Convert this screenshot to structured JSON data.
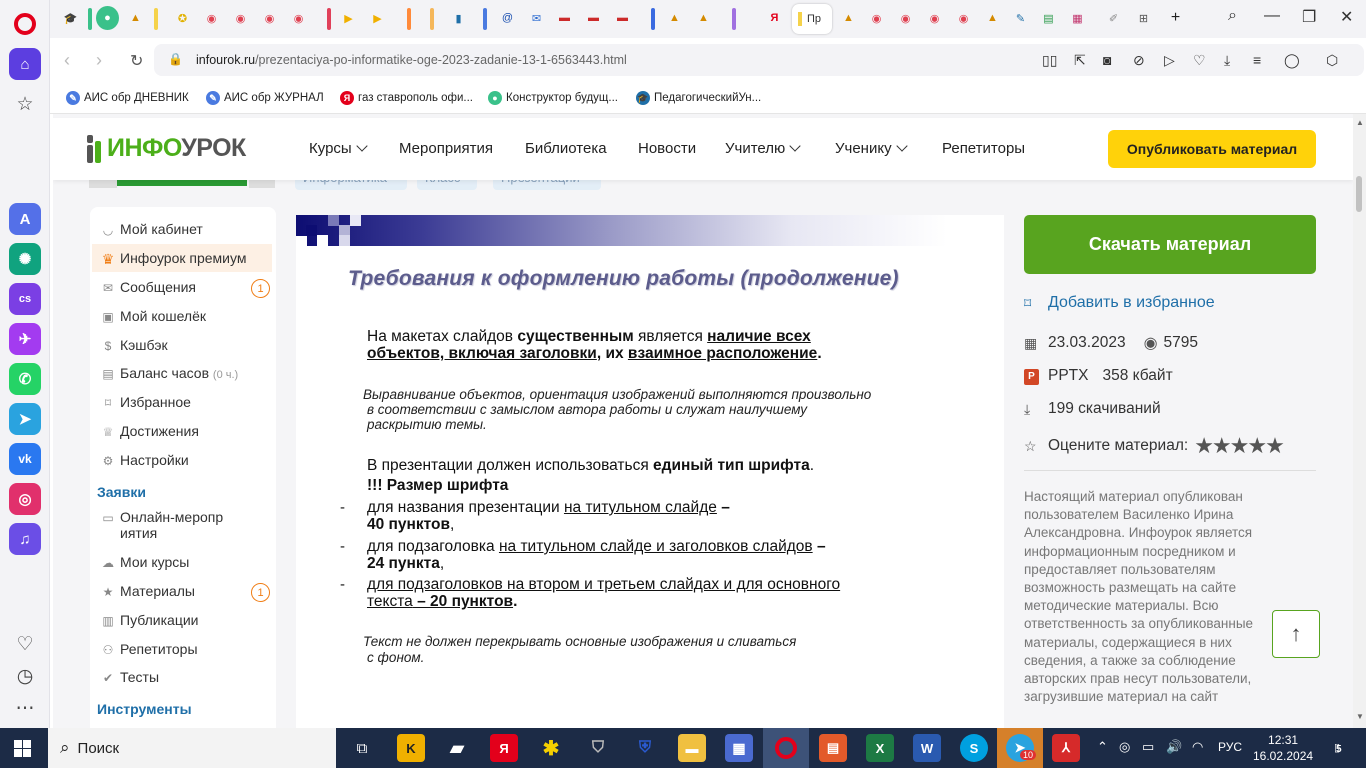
{
  "browser": {
    "active_tab_title": "Пр",
    "url_host": "infourok.ru",
    "url_path": "/prezentaciya-po-informatike-oge-2023-zadanie-13-1-6563443.html",
    "bookmarks": [
      {
        "label": "АИС обр ДНЕВНИК",
        "icon": "ais-icon"
      },
      {
        "label": "АИС обр ЖУРНАЛ",
        "icon": "ais-icon"
      },
      {
        "label": "газ ставрополь офи...",
        "icon": "yandex-icon"
      },
      {
        "label": "Конструктор будущ...",
        "icon": "constructor-icon"
      },
      {
        "label": "ПедагогическийУн...",
        "icon": "graduation-cap-icon"
      }
    ]
  },
  "site": {
    "logo_part1": "ИНФО",
    "logo_part2": "УРОК",
    "nav": [
      {
        "label": "Курсы",
        "dropdown": true
      },
      {
        "label": "Мероприятия",
        "dropdown": false
      },
      {
        "label": "Библиотека",
        "dropdown": false
      },
      {
        "label": "Новости",
        "dropdown": false
      },
      {
        "label": "Учителю",
        "dropdown": true
      },
      {
        "label": "Ученику",
        "dropdown": true
      },
      {
        "label": "Репетиторы",
        "dropdown": false
      }
    ],
    "publish_button": "Опубликовать материал",
    "tags": [
      "Информатика",
      "Класс",
      "Презентации"
    ]
  },
  "left_menu": {
    "items": [
      {
        "label": "Мой кабинет",
        "icon": "person-icon"
      },
      {
        "label": "Инфоурок премиум",
        "icon": "crown-icon"
      },
      {
        "label": "Сообщения",
        "icon": "mail-icon",
        "badge": "1"
      },
      {
        "label": "Мой кошелёк",
        "icon": "wallet-icon"
      },
      {
        "label": "Кэшбэк",
        "icon": "cashback-icon"
      },
      {
        "label": "Баланс часов",
        "icon": "clock-icon",
        "extra": "(0 ч.)"
      },
      {
        "label": "Избранное",
        "icon": "bookmark-icon"
      },
      {
        "label": "Достижения",
        "icon": "trophy-icon"
      },
      {
        "label": "Настройки",
        "icon": "gear-icon"
      }
    ],
    "section_requests": "Заявки",
    "requests": [
      {
        "label": "Онлайн-мероприятия",
        "icon": "video-icon"
      },
      {
        "label": "Мои курсы",
        "icon": "courses-icon"
      },
      {
        "label": "Материалы",
        "icon": "star-icon",
        "badge": "1"
      },
      {
        "label": "Публикации",
        "icon": "book-icon"
      },
      {
        "label": "Репетиторы",
        "icon": "people-icon"
      },
      {
        "label": "Тесты",
        "icon": "check-circle-icon"
      }
    ],
    "section_tools": "Инструменты"
  },
  "slide": {
    "title": "Требования к оформлению работы (продолжение)",
    "p1_a": "На макетах  слайдов ",
    "p1_b": "существенным",
    "p1_c": " является ",
    "p1_d": "наличие всех",
    "p1_e": "объектов, включая заголовки",
    "p1_f": ", их ",
    "p1_g": "взаимное расположение",
    "p1_h": ".",
    "p2_1": "Выравнивание объектов, ориентация изображений выполняются произвольно",
    "p2_2": "в соответствии с замыслом автора работы и служат наилучшему",
    "p2_3": "раскрытию темы.",
    "p3_a": "В презентации должен использоваться ",
    "p3_b": "единый тип шрифта",
    "p3_c": ".",
    "p4": "!!!  Размер шрифта",
    "b1_a": "для названия презентации ",
    "b1_b": "на титульном слайде",
    "b1_c": " –",
    "b1_d": "40 пунктов",
    "b1_e": ",",
    "b2_a": "для подзаголовка ",
    "b2_b": "на титульном слайде и заголовков слайдов",
    "b2_c": " –",
    "b2_d": "24 пункта",
    "b2_e": ",",
    "b3_a": "для подзаголовков на втором и третьем  слайдах и для основного",
    "b3_b": "текста",
    "b3_c": " – 20 пунктов",
    "b3_d": ".",
    "dash": "-",
    "p5_1": "Текст не должен перекрывать основные изображения и сливаться",
    "p5_2": "с фоном."
  },
  "right_panel": {
    "download_button": "Скачать материал",
    "favorite": "Добавить в избранное",
    "date": "23.03.2023",
    "views": "5795",
    "format": "PPTX",
    "size": "358 кбайт",
    "downloads": "199 скачиваний",
    "rate_label": "Оцените материал:",
    "stars": "★★★★★",
    "description": "Настоящий материал опубликован пользователем Василенко Ирина Александровна. Инфоурок является информационным посредником и предоставляет пользователям возможность размещать на сайте методические материалы. Всю ответственность за опубликованные материалы, содержащиеся в них сведения, а также за соблюдение авторских прав несут пользователи, загрузившие материал на сайт"
  },
  "taskbar": {
    "search_placeholder": "Поиск",
    "language": "РУС",
    "time": "12:31",
    "date": "16.02.2024",
    "notifications": "5",
    "telegram_badge": "10"
  },
  "colors": {
    "brand_green": "#58a41f",
    "logo_green": "#4caf1a",
    "accent_yellow": "#ffd20a",
    "link_blue": "#1f6fa8",
    "badge_orange": "#f07e16",
    "slide_title": "#5c5c8c"
  }
}
